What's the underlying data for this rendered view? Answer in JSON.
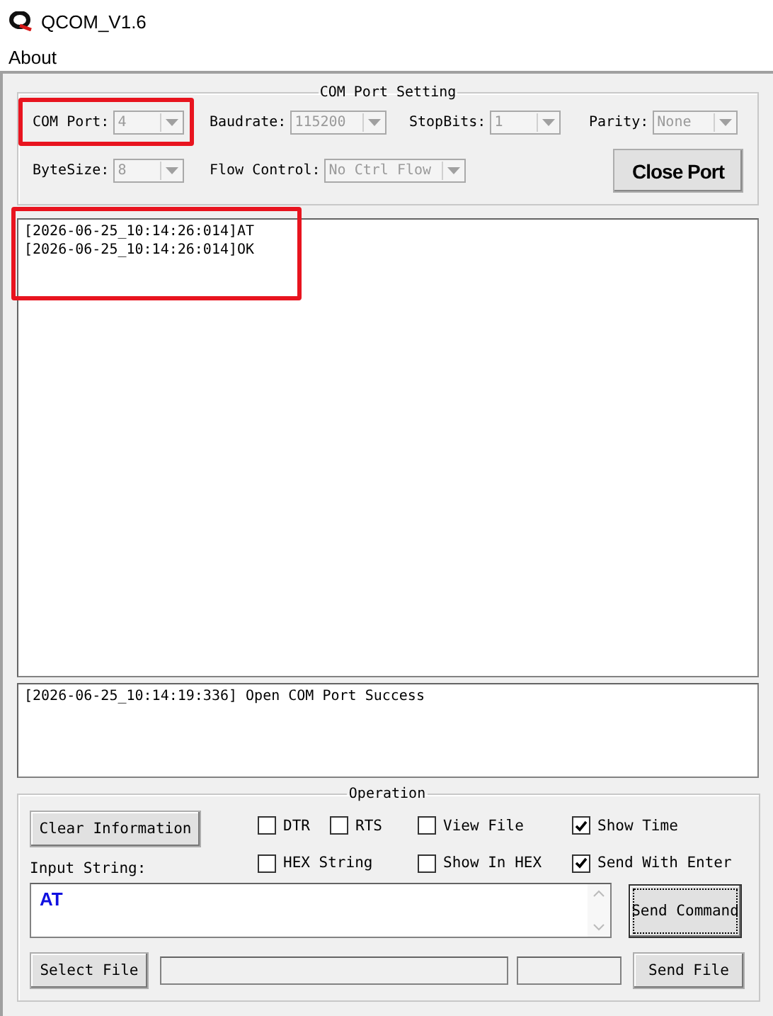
{
  "window": {
    "title": "QCOM_V1.6"
  },
  "menu": [
    "About"
  ],
  "com_port_setting": {
    "title": "COM Port Setting",
    "fields": [
      {
        "label": "COM Port:",
        "value": "4",
        "highlighted": true
      },
      {
        "label": "Baudrate:",
        "value": "115200",
        "highlighted": false
      },
      {
        "label": "StopBits:",
        "value": "1",
        "highlighted": false
      },
      {
        "label": "Parity:",
        "value": "None",
        "highlighted": false
      },
      {
        "label": "ByteSize:",
        "value": "8",
        "highlighted": false
      },
      {
        "label": "Flow Control:",
        "value": "No Ctrl Flow",
        "highlighted": false
      }
    ],
    "close_button": "Close Port"
  },
  "receive_log": {
    "highlighted": true,
    "lines": [
      "[2026-06-25_10:14:26:014]AT",
      "[2026-06-25_10:14:26:014]OK"
    ]
  },
  "status_log": {
    "lines": [
      "[2026-06-25_10:14:19:336] Open COM Port Success"
    ]
  },
  "operation": {
    "title": "Operation",
    "clear_button": "Clear Information",
    "options": [
      {
        "label": "DTR",
        "checked": false
      },
      {
        "label": "RTS",
        "checked": false
      },
      {
        "label": "View File",
        "checked": false
      },
      {
        "label": "Show Time",
        "checked": true
      },
      {
        "label": "HEX String",
        "checked": false
      },
      {
        "label": "Show In HEX",
        "checked": false
      },
      {
        "label": "Send With Enter",
        "checked": true
      }
    ],
    "input_label": "Input String:",
    "input_value": "AT",
    "send_command": "Send Command",
    "select_file": "Select File",
    "send_file": "Send File"
  }
}
